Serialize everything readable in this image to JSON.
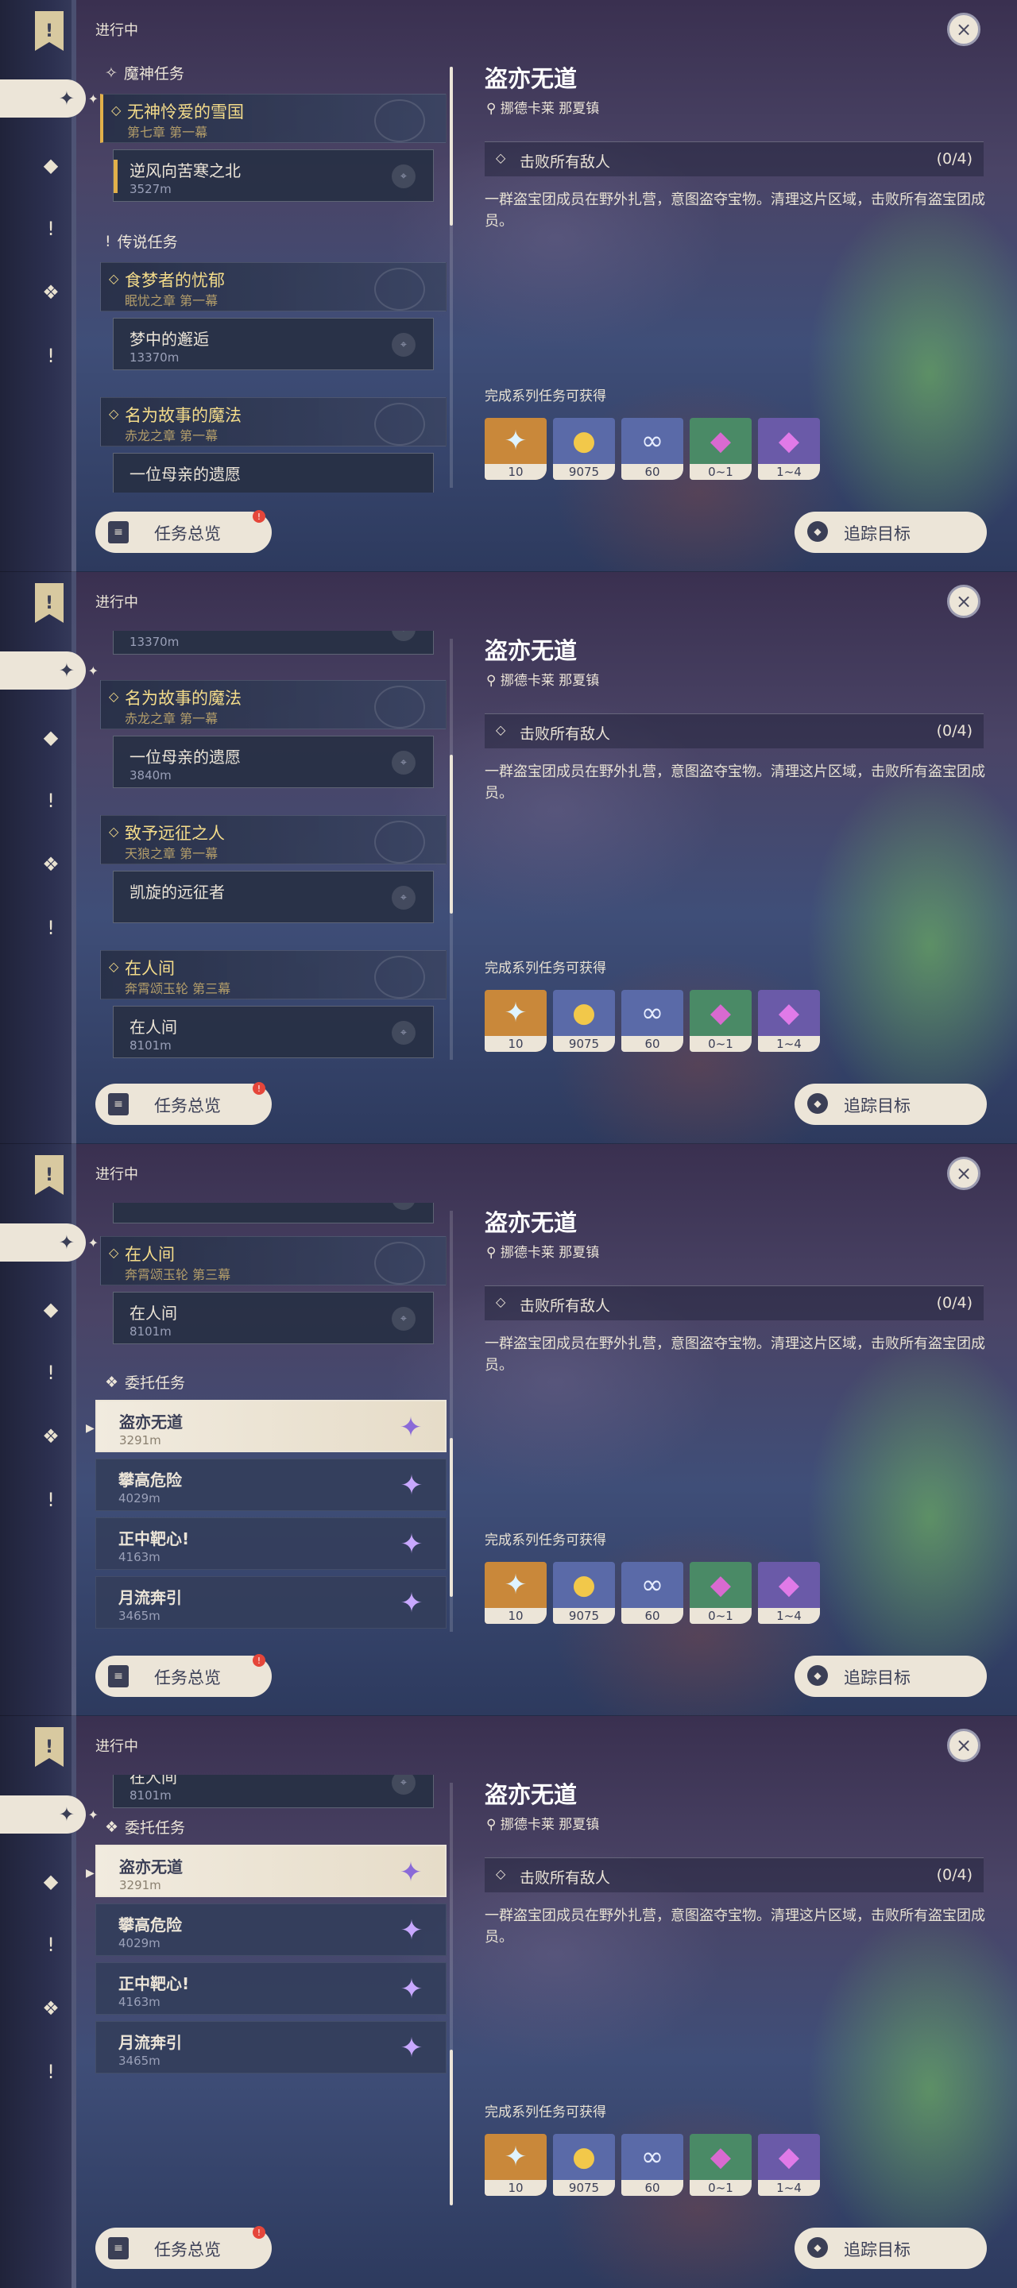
{
  "header": {
    "in_progress": "进行中",
    "banner_glyph": "!",
    "close_icon": "×"
  },
  "rail": {
    "icons": [
      {
        "name": "archon-icon",
        "glyph": "✦"
      },
      {
        "name": "story-icon",
        "glyph": "◆"
      },
      {
        "name": "legend-icon",
        "glyph": "!"
      },
      {
        "name": "commission-icon",
        "glyph": "❖"
      },
      {
        "name": "event-icon",
        "glyph": "!"
      }
    ]
  },
  "sections": {
    "archon": "魔神任务",
    "legend": "传说任务",
    "commission": "委托任务"
  },
  "quests": {
    "q_snow": {
      "title": "无神怜爱的雪国",
      "sub": "第七章 第一幕"
    },
    "q_snow_step": {
      "title": "逆风向苦寒之北",
      "dist": "3527m"
    },
    "q_dream": {
      "title": "食梦者的忧郁",
      "sub": "眠忧之章 第一幕"
    },
    "q_dream_step": {
      "title": "梦中的邂逅",
      "dist": "13370m"
    },
    "q_magic": {
      "title": "名为故事的魔法",
      "sub": "赤龙之章 第一幕"
    },
    "q_magic_step": {
      "title": "一位母亲的遗愿",
      "dist": "3840m"
    },
    "q_expedition": {
      "title": "致予远征之人",
      "sub": "天狼之章 第一幕"
    },
    "q_expedition_step": {
      "title": "凯旋的远征者"
    },
    "q_world": {
      "title": "在人间",
      "sub": "奔霄颂玉轮 第三幕"
    },
    "q_world_step": {
      "title": "在人间",
      "dist": "8101m"
    }
  },
  "commissions": [
    {
      "title": "盗亦无道",
      "dist": "3291m"
    },
    {
      "title": "攀高危险",
      "dist": "4029m"
    },
    {
      "title": "正中靶心!",
      "dist": "4163m"
    },
    {
      "title": "月流奔引",
      "dist": "3465m"
    }
  ],
  "detail": {
    "title": "盗亦无道",
    "location": "挪德卡莱 那夏镇",
    "objective": "击败所有敌人",
    "objective_count": "(0/4)",
    "description": "一群盗宝团成员在野外扎营，意图盗夺宝物。清理这片区域，击败所有盗宝团成员。",
    "reward_header": "完成系列任务可获得",
    "rewards": [
      {
        "icon": "primogem-icon",
        "glyph": "✦",
        "count": "10",
        "bg": "#c9883a",
        "fg": "#dff4ff"
      },
      {
        "icon": "mora-icon",
        "glyph": "●",
        "count": "9075",
        "bg": "#5a6aa8",
        "fg": "#f2c84a"
      },
      {
        "icon": "friendship-icon",
        "glyph": "∞",
        "count": "60",
        "bg": "#5a6aa8",
        "fg": "#e6ecff"
      },
      {
        "icon": "crystal-icon",
        "glyph": "◆",
        "count": "0~1",
        "bg": "#4a8a66",
        "fg": "#d86ad0"
      },
      {
        "icon": "crystal-cluster-icon",
        "glyph": "◆",
        "count": "1~4",
        "bg": "#6a5aa8",
        "fg": "#e07ae8"
      }
    ]
  },
  "buttons": {
    "overview": "任务总览",
    "track": "追踪目标",
    "badge": "!"
  }
}
